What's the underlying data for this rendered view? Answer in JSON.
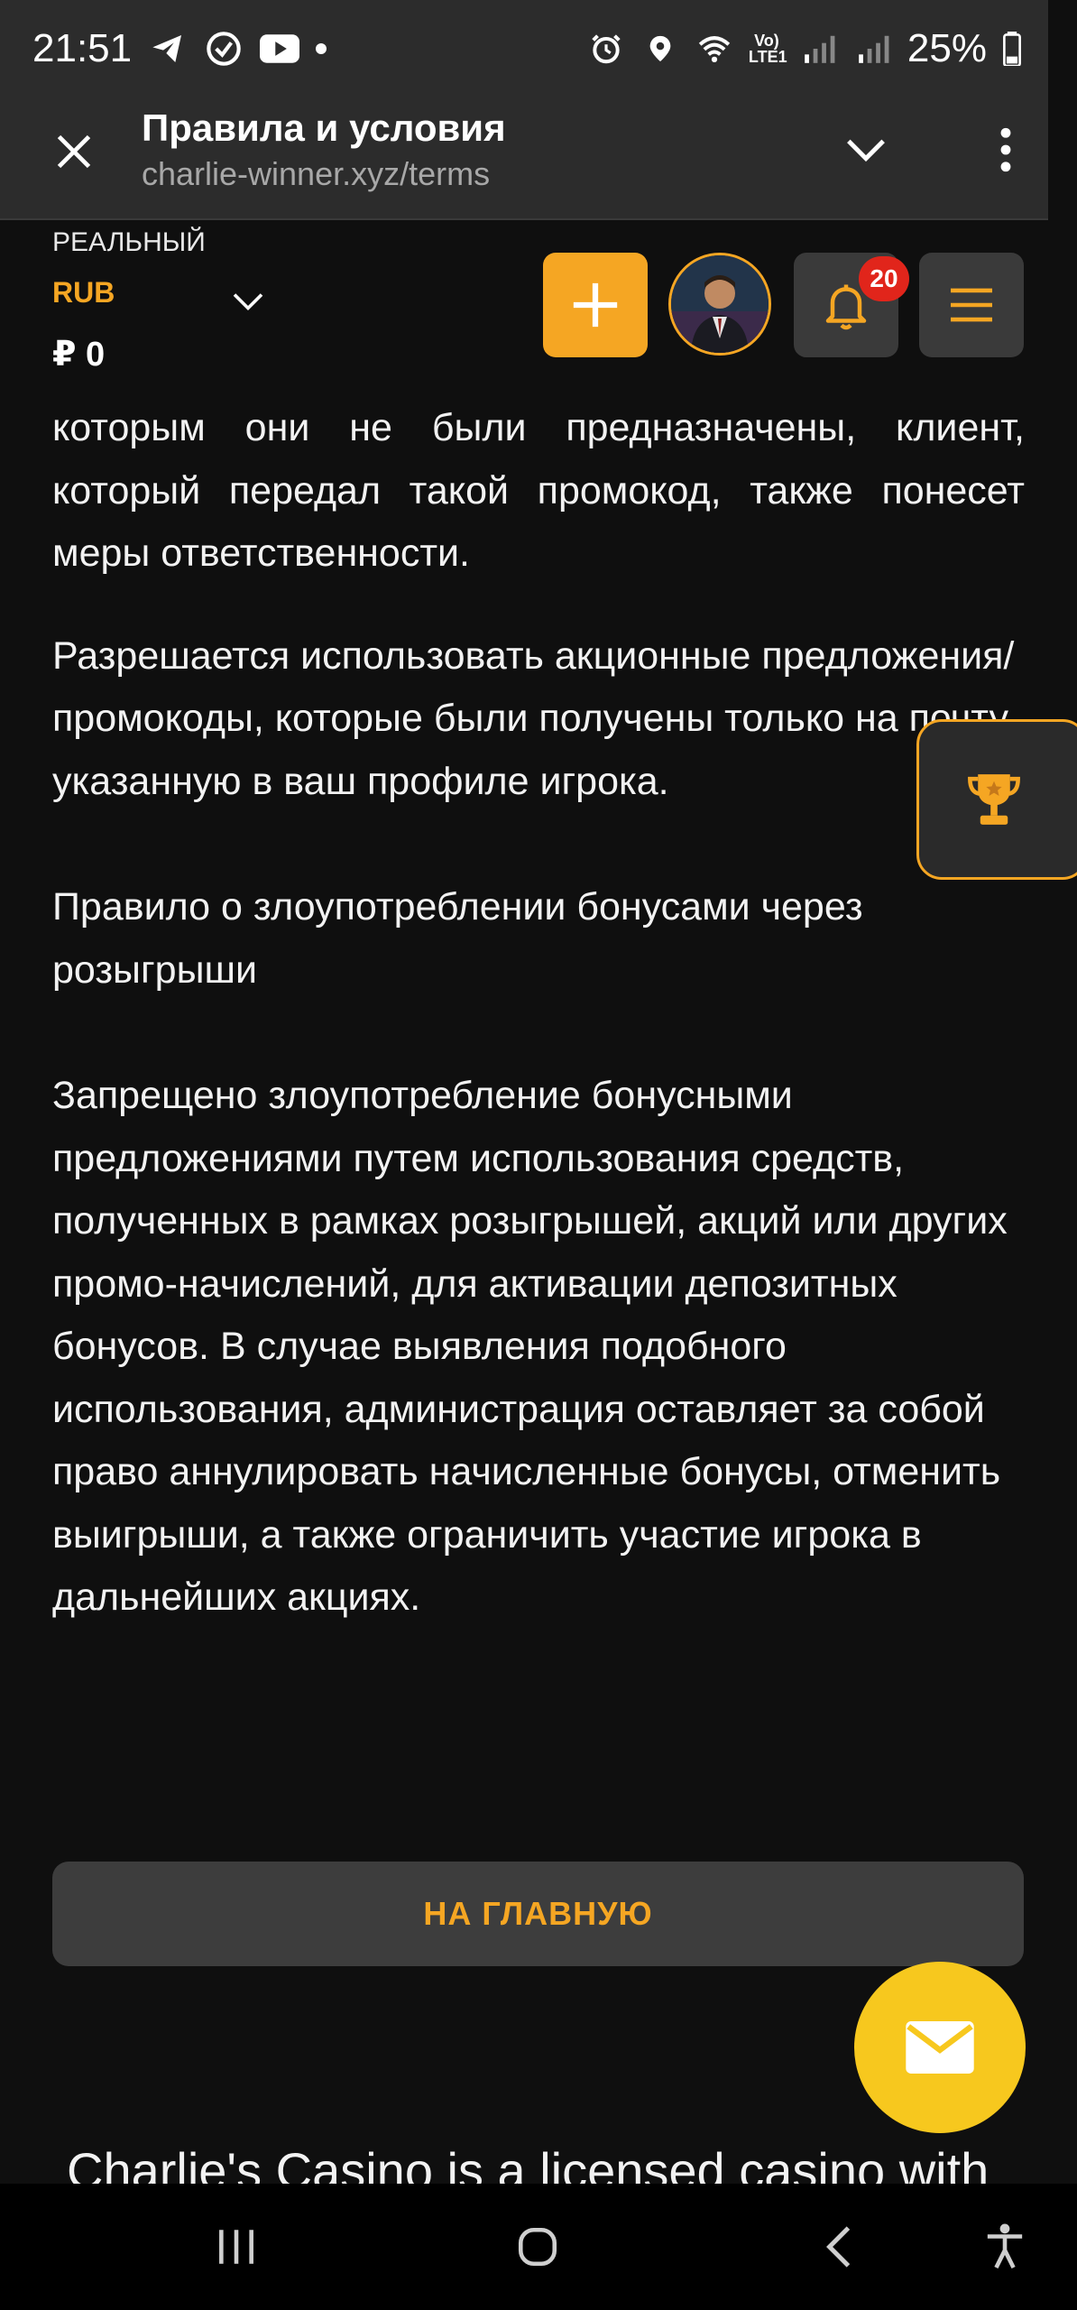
{
  "status_bar": {
    "time": "21:51",
    "battery": "25%",
    "network_label": "Vo) LTE1"
  },
  "browser": {
    "title": "Правила и условия",
    "url": "charlie-winner.xyz/terms"
  },
  "header": {
    "account_type": "РЕАЛЬНЫЙ",
    "currency": "RUB",
    "balance": "₽ 0",
    "notifications_count": "20"
  },
  "content": {
    "p1": "которым они не были предназначены, клиент, который передал такой промокод, также понесет меры ответственности.",
    "p2": "Разрешается использовать акционные предложения/промокоды, которые были получены только на почту указанную в ваш профиле игрока.",
    "p3": "Правило о злоупотреблении бонусами через розыгрыши",
    "p4": "Запрещено злоупотребление бонусными предложениями путем использования средств, полученных в рамках розыгрышей, акций или других промо-начислений, для активации депозитных бонусов. В случае выявления подобного использования, администрация оставляет за собой право аннулировать начисленные бонусы, отменить выигрыши, а также ограничить участие игрока в дальнейших акциях."
  },
  "home_button": {
    "label": "НА ГЛАВНУЮ"
  },
  "footer": {
    "text": "Charlie's Casino is a licensed casino with"
  },
  "colors": {
    "accent": "#f5a623",
    "background": "#0f0f0f",
    "badge": "#e1251b",
    "mail_button": "#f7c81e"
  },
  "icons": [
    "telegram-icon",
    "check-circle-icon",
    "youtube-icon",
    "alarm-icon",
    "location-icon",
    "wifi-icon",
    "signal-icon",
    "battery-icon",
    "close-icon",
    "chevron-down-icon",
    "more-vert-icon",
    "plus-icon",
    "bell-icon",
    "menu-icon",
    "trophy-icon",
    "mail-icon",
    "recent-apps-icon",
    "home-icon",
    "back-icon",
    "accessibility-icon"
  ]
}
